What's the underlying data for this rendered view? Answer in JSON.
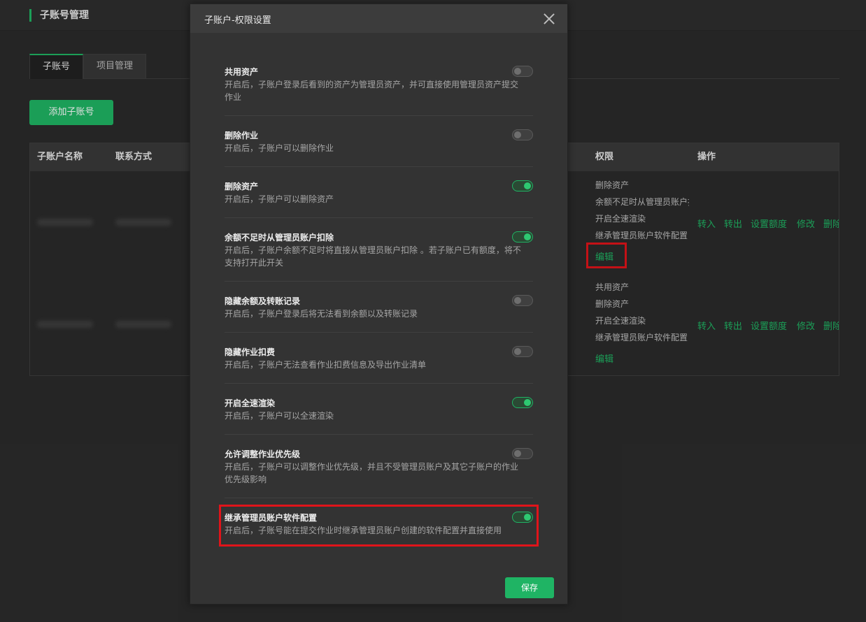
{
  "page": {
    "title": "子账号管理",
    "tabs": [
      {
        "label": "子账号"
      },
      {
        "label": "项目管理"
      }
    ],
    "add_button": "添加子账号"
  },
  "table": {
    "headers": [
      "子账户名称",
      "联系方式",
      "权限",
      "操作"
    ],
    "rows": [
      {
        "permissions": [
          "删除资产",
          "余额不足时从管理员账户扣除",
          "开启全速渲染",
          "继承管理员账户软件配置"
        ],
        "edit": "编辑",
        "ops": [
          "转入",
          "转出",
          "设置额度",
          "修改",
          "删除"
        ]
      },
      {
        "permissions": [
          "共用资产",
          "删除资产",
          "开启全速渲染",
          "继承管理员账户软件配置"
        ],
        "edit": "编辑",
        "ops": [
          "转入",
          "转出",
          "设置额度",
          "修改",
          "删除"
        ]
      }
    ]
  },
  "modal": {
    "title": "子账户-权限设置",
    "options": [
      {
        "title": "共用资产",
        "desc": "开启后，子账户登录后看到的资产为管理员资产，并可直接使用管理员资产提交作业",
        "enabled": false
      },
      {
        "title": "删除作业",
        "desc": "开启后，子账户可以删除作业",
        "enabled": false
      },
      {
        "title": "删除资产",
        "desc": "开启后，子账户可以删除资产",
        "enabled": true
      },
      {
        "title": "余额不足时从管理员账户扣除",
        "desc": "开启后，子账户余额不足时将直接从管理员账户扣除 。若子账户已有额度，将不支持打开此开关",
        "enabled": true
      },
      {
        "title": "隐藏余额及转账记录",
        "desc": "开启后，子账户登录后将无法看到余额以及转账记录",
        "enabled": false
      },
      {
        "title": "隐藏作业扣费",
        "desc": "开启后，子账户无法查看作业扣费信息及导出作业清单",
        "enabled": false
      },
      {
        "title": "开启全速渲染",
        "desc": "开启后，子账户可以全速渲染",
        "enabled": true
      },
      {
        "title": "允许调整作业优先级",
        "desc": "开启后，子账户可以调整作业优先级，并且不受管理员账户及其它子账户的作业优先级影响",
        "enabled": false
      },
      {
        "title": "继承管理员账户软件配置",
        "desc": "开启后，子账号能在提交作业时继承管理员账户创建的软件配置并直接使用",
        "enabled": true
      }
    ],
    "save_label": "保存"
  },
  "colors": {
    "accent": "#1fb464",
    "highlight": "#e0141a"
  }
}
